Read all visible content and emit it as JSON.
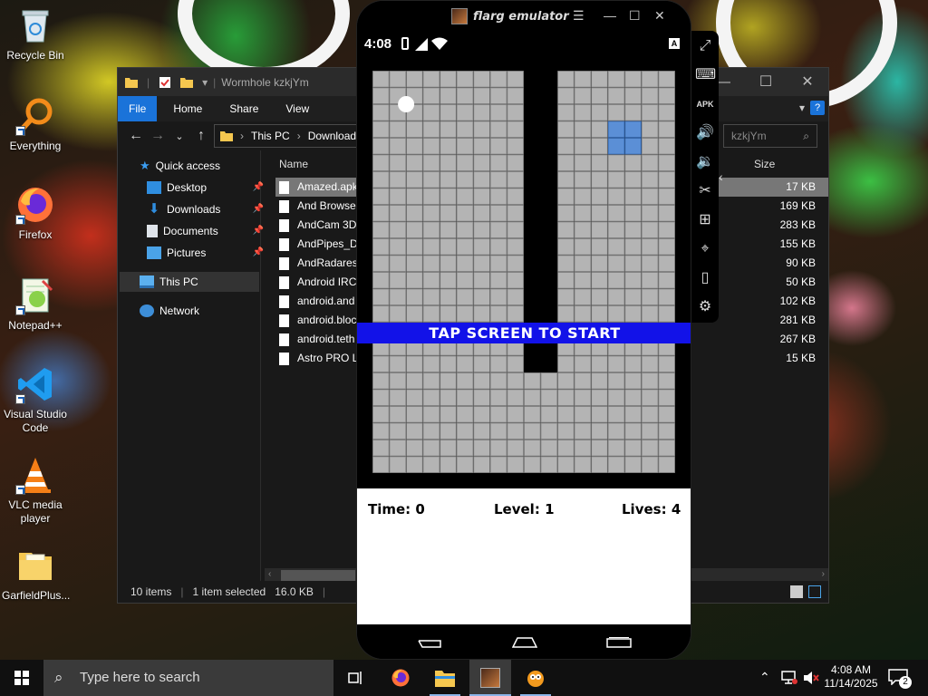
{
  "desktop": {
    "icons": [
      {
        "label": "Recycle Bin",
        "icon": "recycle-bin-icon"
      },
      {
        "label": "Everything",
        "icon": "everything-search-icon"
      },
      {
        "label": "Firefox",
        "icon": "firefox-icon"
      },
      {
        "label": "Notepad++",
        "icon": "notepad-plus-plus-icon"
      },
      {
        "label": "Visual Studio Code",
        "icon": "vscode-icon"
      },
      {
        "label": "VLC media player",
        "icon": "vlc-icon"
      },
      {
        "label": "GarfieldPlus...",
        "icon": "folder-icon"
      }
    ]
  },
  "explorer": {
    "title": "Wormhole kzkjYm",
    "ribbon_tabs": [
      "File",
      "Home",
      "Share",
      "View"
    ],
    "address": {
      "root": "This PC",
      "current": "Downloads"
    },
    "search_placeholder": "kzkjYm",
    "nav": {
      "quick_access": "Quick access",
      "items": [
        "Desktop",
        "Downloads",
        "Documents",
        "Pictures"
      ],
      "this_pc": "This PC",
      "network": "Network"
    },
    "columns": {
      "name": "Name",
      "size": "Size"
    },
    "files": [
      {
        "name": "Amazed.apk",
        "size": "17 KB",
        "selected": true
      },
      {
        "name": "And Browser",
        "size": "169 KB"
      },
      {
        "name": "AndCam 3D",
        "size": "283 KB"
      },
      {
        "name": "AndPipes_De",
        "size": "155 KB"
      },
      {
        "name": "AndRadares",
        "size": "90 KB"
      },
      {
        "name": "Android IRC",
        "size": "50 KB"
      },
      {
        "name": "android.and",
        "size": "102 KB"
      },
      {
        "name": "android.bloc",
        "size": "281 KB"
      },
      {
        "name": "android.teth",
        "size": "267 KB"
      },
      {
        "name": "Astro PRO Li",
        "size": "15 KB"
      }
    ],
    "status": {
      "count": "10 items",
      "selected": "1 item selected",
      "size": "16.0 KB"
    }
  },
  "emulator": {
    "title": "flarg emulator",
    "phone_time": "4:08",
    "banner": "TAP SCREEN TO START",
    "hud": {
      "time_label": "Time:",
      "time_value": "0",
      "level_label": "Level:",
      "level_value": "1",
      "lives_label": "Lives:",
      "lives_value": "4"
    },
    "tools": [
      "fullscreen-icon",
      "keyboard-icon",
      "apk-install-icon",
      "volume-up-icon",
      "volume-down-icon",
      "screenshot-icon",
      "add-icon",
      "location-icon",
      "shake-icon",
      "settings-icon"
    ],
    "colors": {
      "banner": "#1212e8",
      "tile": "#b4b4b4",
      "target": "#5b8fd6",
      "ball": "#ffffff"
    }
  },
  "taskbar": {
    "search_placeholder": "Type here to search",
    "clock_time": "4:08 AM",
    "clock_date": "11/14/2025",
    "notification_count": "2"
  }
}
